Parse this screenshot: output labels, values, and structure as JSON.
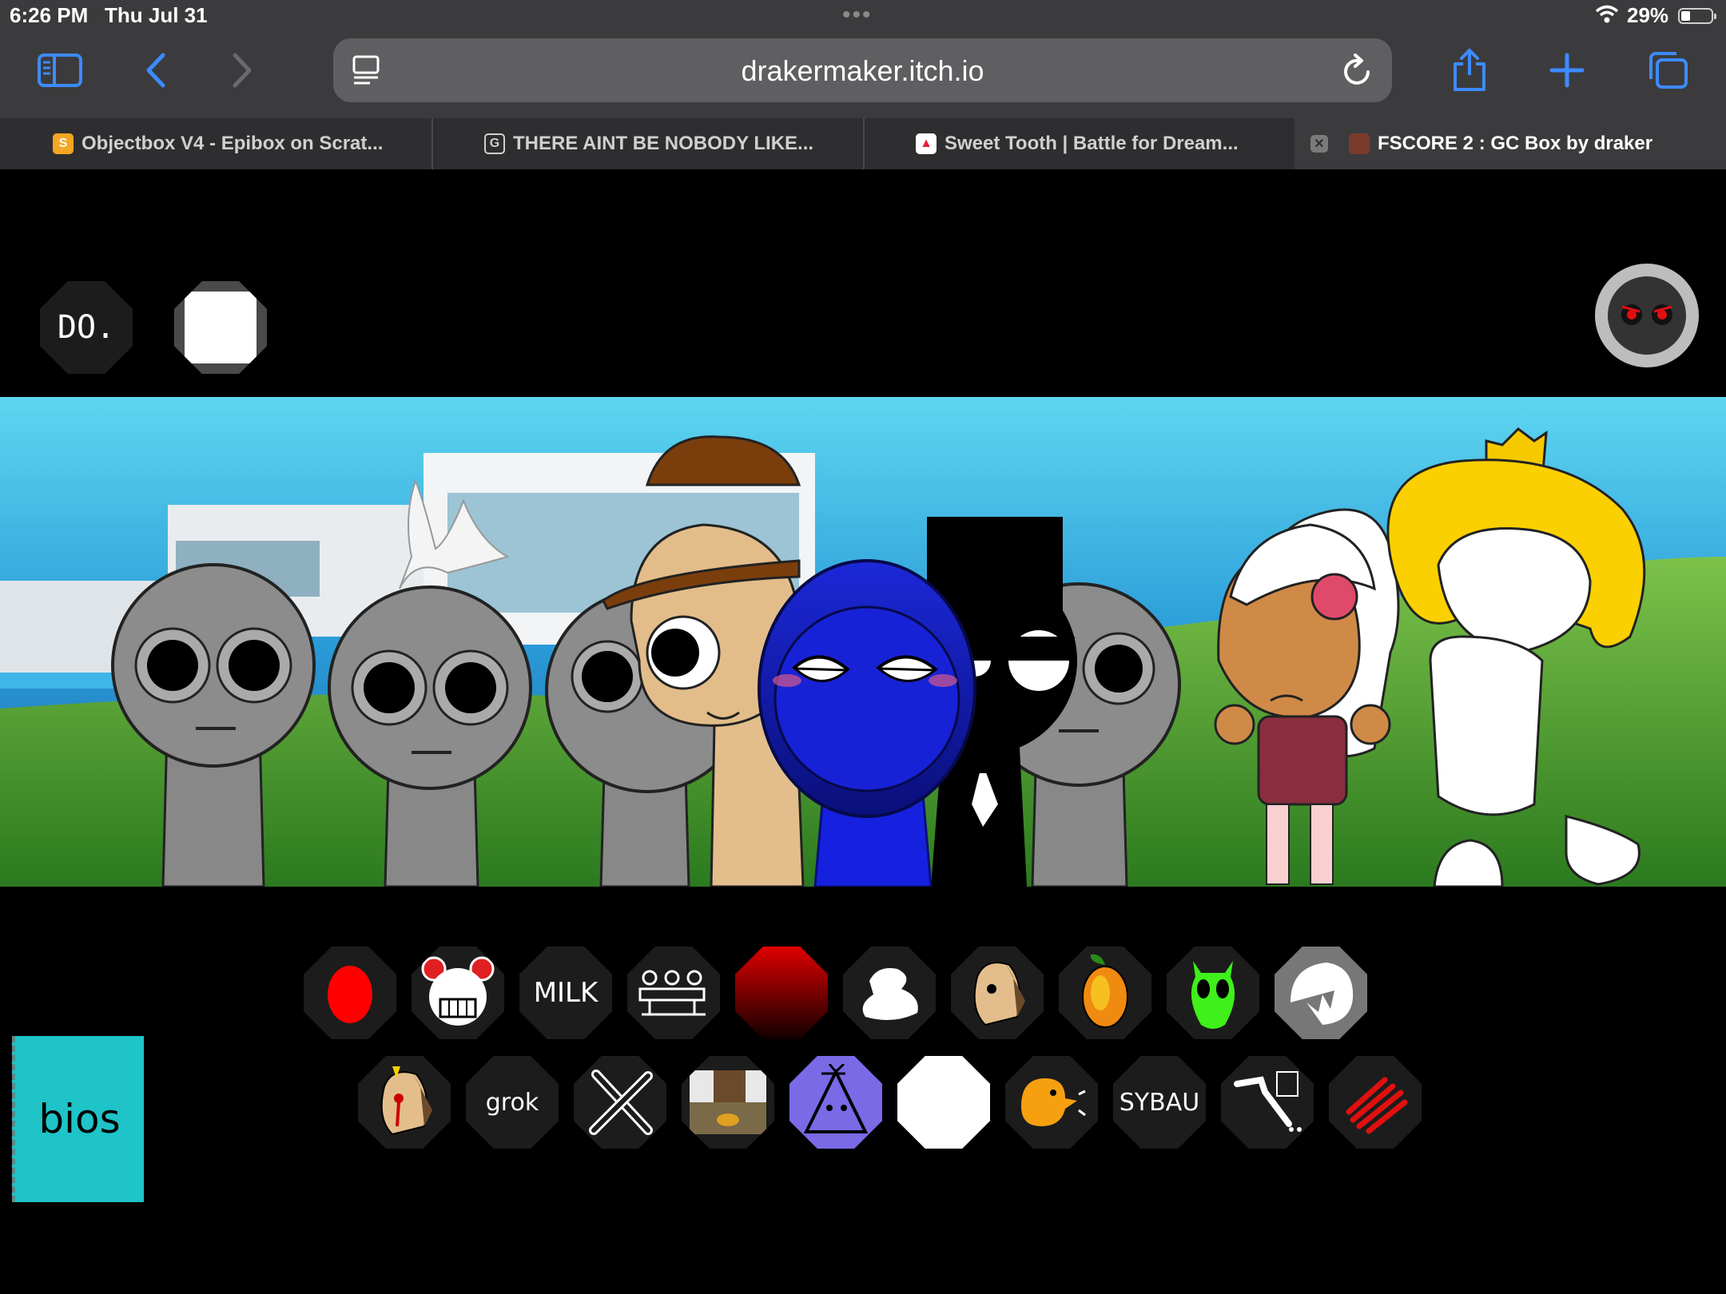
{
  "status_bar": {
    "time": "6:26 PM",
    "date": "Thu Jul 31",
    "battery": "29%"
  },
  "browser": {
    "url": "drakermaker.itch.io",
    "tabs": [
      {
        "title": "Objectbox V4 - Epibox on Scrat...",
        "favicon": "scratch-icon",
        "active": false
      },
      {
        "title": "THERE AINT BE NOBODY LIKE...",
        "favicon": "g-icon",
        "active": false
      },
      {
        "title": "Sweet Tooth | Battle for Dream...",
        "favicon": "fire-icon",
        "active": false
      },
      {
        "title": "FSCORE 2 : GC Box by draker",
        "favicon": "gcbox-icon",
        "active": true
      }
    ]
  },
  "game": {
    "do_button_label": "DO.",
    "bios_label": "bios",
    "row1_icons": [
      "red-egg",
      "mouse-face",
      "MILK",
      "machine-doodle",
      "red-gradient-block",
      "white-blob",
      "horse-face",
      "mango",
      "green-alien",
      "white-swirl"
    ],
    "row2_icons": [
      "bleeding-horse-face",
      "grok",
      "white-x",
      "pixel-photo",
      "purple-triangle",
      "white-octagon",
      "orange-bird",
      "SYBAU",
      "nail-doodle",
      "red-scratches"
    ],
    "row1_text": {
      "milk": "MILK"
    },
    "row2_text": {
      "grok": "grok",
      "sybau": "SYBAU"
    }
  }
}
